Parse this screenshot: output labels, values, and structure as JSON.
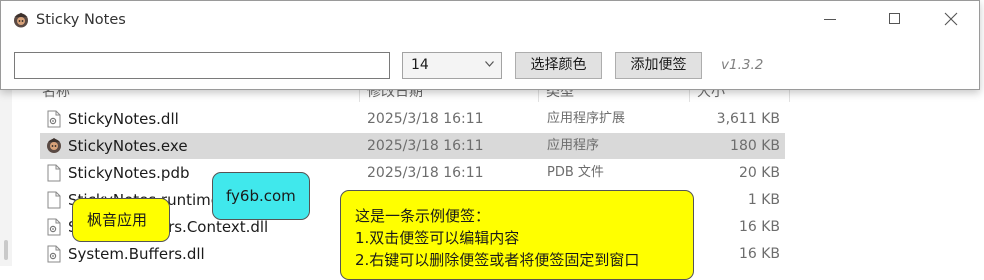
{
  "window": {
    "title": "Sticky Notes",
    "icon": "sticky-notes-app-icon",
    "controls": [
      "minimize-icon",
      "maximize-icon",
      "close-icon"
    ]
  },
  "toolbar": {
    "note_input_value": "",
    "font_size_selected": "14",
    "select_color_label": "选择颜色",
    "add_note_label": "添加便签",
    "version": "v1.3.2"
  },
  "explorer": {
    "headers": [
      "名称",
      "修改日期",
      "类型",
      "大小"
    ],
    "rows": [
      {
        "name": "StickyNotes.dll",
        "date": "2025/3/18 16:11",
        "type": "应用程序扩展",
        "size": "3,611 KB",
        "icon": "dll-file-icon"
      },
      {
        "name": "StickyNotes.exe",
        "date": "2025/3/18 16:11",
        "type": "应用程序",
        "size": "180 KB",
        "icon": "app-exe-icon"
      },
      {
        "name": "StickyNotes.pdb",
        "date": "2025/3/18 16:11",
        "type": "PDB 文件",
        "size": "20 KB",
        "icon": "file-icon"
      },
      {
        "name": "StickyNotes.runtimeconfig.json",
        "date": "",
        "type": "",
        "size": "1 KB",
        "icon": "file-icon"
      },
      {
        "name": "System.Buffers.Context.dll",
        "date": "",
        "type": "",
        "size": "16 KB",
        "icon": "dll-file-icon"
      },
      {
        "name": "System.Buffers.dll",
        "date": "",
        "type": "",
        "size": "16 KB",
        "icon": "dll-file-icon"
      }
    ]
  },
  "notes": [
    {
      "text": "枫音应用",
      "color": "#ffff00"
    },
    {
      "text": "fy6b.com",
      "color": "#40e8ec"
    },
    {
      "lines": [
        "这是一条示例便签：",
        "1.双击便签可以编辑内容",
        "2.右键可以删除便签或者将便签固定到窗口"
      ],
      "color": "#ffff00"
    }
  ],
  "colors": {
    "selected_row": "#d9d9d9",
    "button_face": "#e1e1e1"
  }
}
